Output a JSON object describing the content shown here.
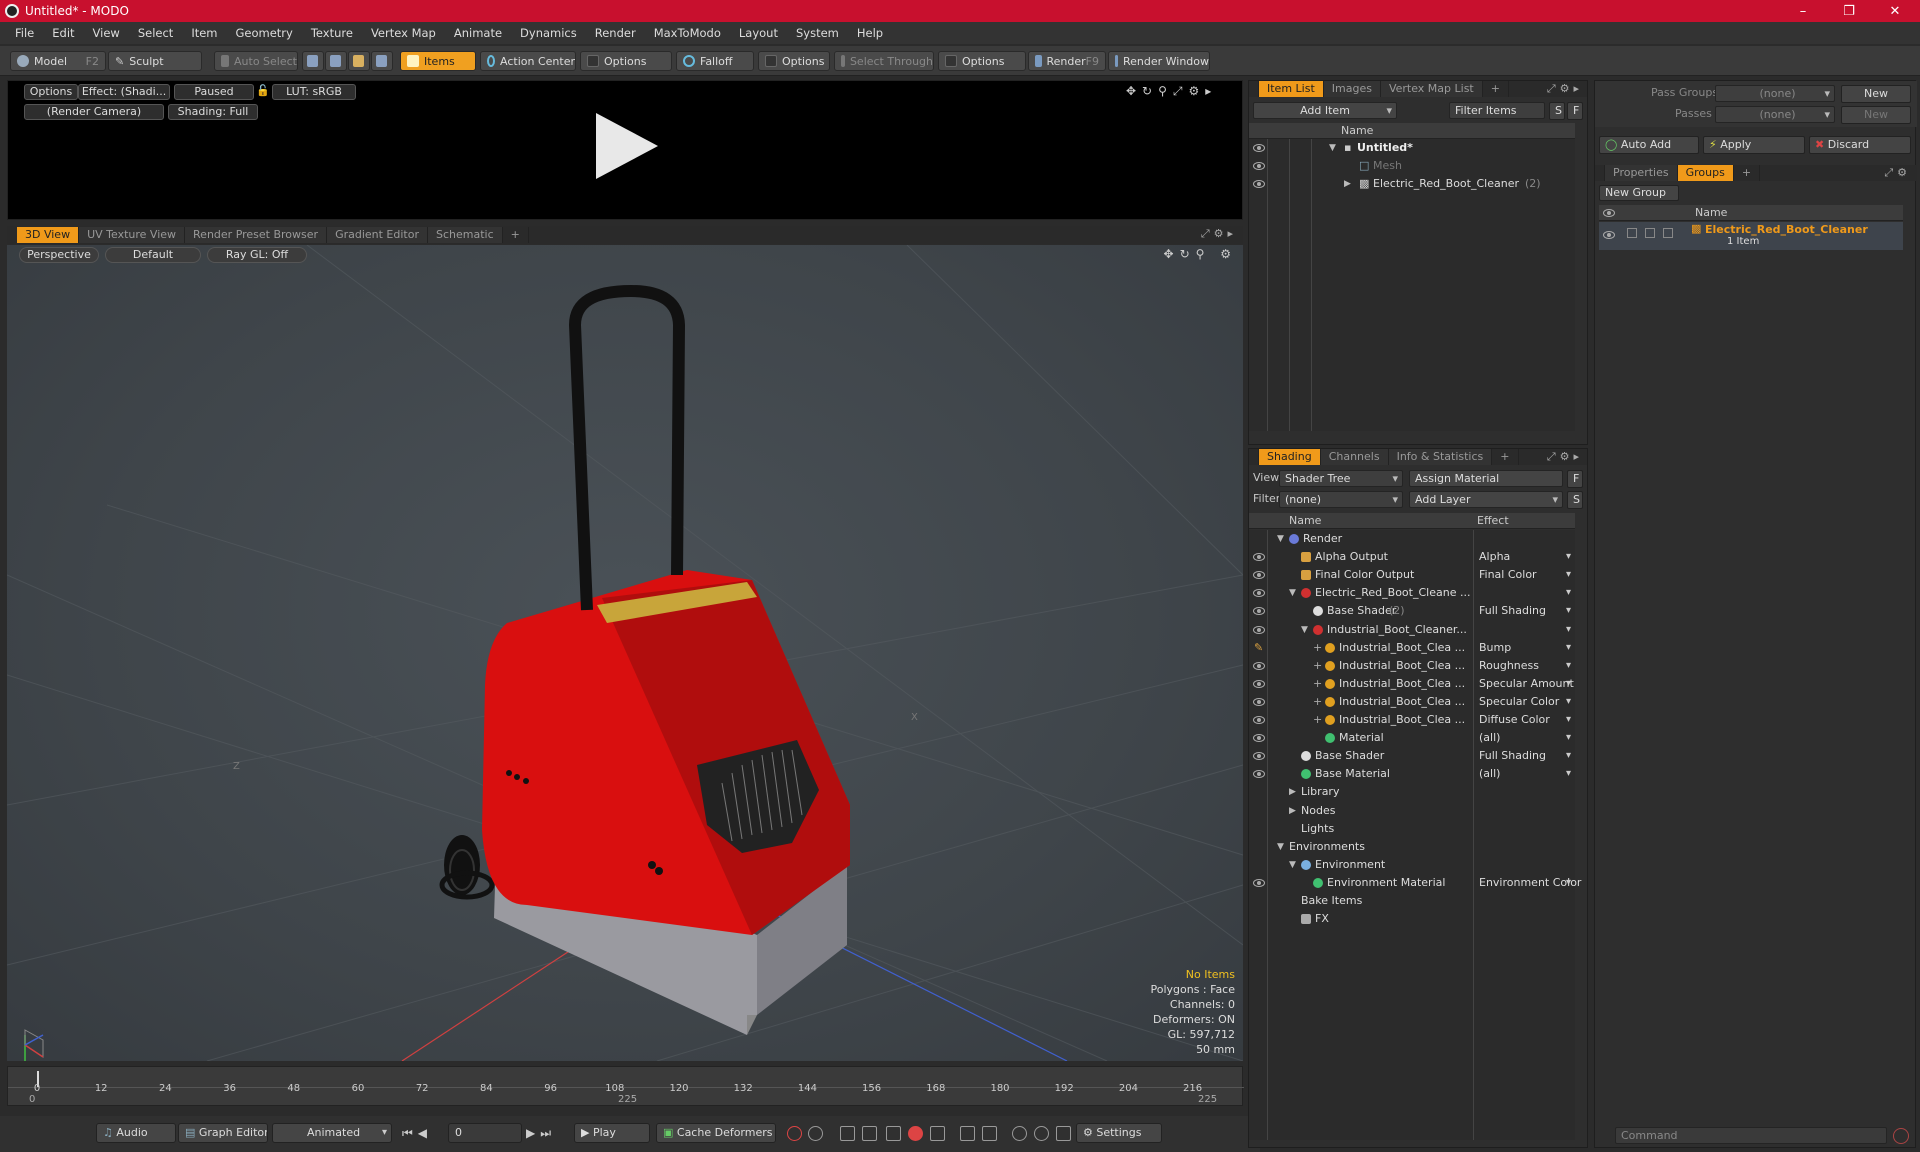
{
  "window": {
    "title": "Untitled* - MODO",
    "min": "–",
    "max": "❐",
    "close": "✕"
  },
  "menu": [
    "File",
    "Edit",
    "View",
    "Select",
    "Item",
    "Geometry",
    "Texture",
    "Vertex Map",
    "Animate",
    "Dynamics",
    "Render",
    "MaxToModo",
    "Layout",
    "System",
    "Help"
  ],
  "toolbar": {
    "model": "Model",
    "model_key": "F2",
    "sculpt": "Sculpt",
    "auto_select": "Auto Select",
    "items": "Items",
    "action_center": "Action Center",
    "options1": "Options",
    "falloff": "Falloff",
    "options2": "Options",
    "select_through": "Select Through",
    "options3": "Options",
    "render": "Render",
    "render_key": "F9",
    "render_window": "Render Window"
  },
  "preview": {
    "options": "Options",
    "effect": "Effect: (Shadi...",
    "paused": "Paused",
    "lut": "LUT: sRGB",
    "camera": "(Render Camera)",
    "shading": "Shading: Full"
  },
  "viewtabs": [
    "3D View",
    "UV Texture View",
    "Render Preset Browser",
    "Gradient Editor",
    "Schematic",
    "+"
  ],
  "viewport": {
    "perspective": "Perspective",
    "default": "Default",
    "raygl": "Ray GL: Off",
    "axis_z": "Z",
    "axis_x": "X"
  },
  "stats": {
    "items": "No Items",
    "polygons": "Polygons : Face",
    "channels": "Channels: 0",
    "deformers": "Deformers: ON",
    "gl": "GL: 597,712",
    "size": "50 mm"
  },
  "timeline": {
    "ticks": [
      "0",
      "12",
      "24",
      "36",
      "48",
      "60",
      "72",
      "84",
      "96",
      "108",
      "120",
      "132",
      "144",
      "156",
      "168",
      "180",
      "192",
      "204",
      "216"
    ],
    "start": "0",
    "mid": "225",
    "end": "225"
  },
  "bottombar": {
    "audio": "Audio",
    "graph_editor": "Graph Editor",
    "animated": "Animated",
    "frame": "0",
    "play": "Play",
    "cache": "Cache Deformers",
    "settings": "Settings"
  },
  "itemlist": {
    "tabs": [
      "Item List",
      "Images",
      "Vertex Map List",
      "+"
    ],
    "add_item": "Add Item",
    "filter": "Filter Items",
    "f": "F",
    "s": "S",
    "col_name": "Name",
    "rows": [
      {
        "label": "Untitled*"
      },
      {
        "label": "Mesh"
      },
      {
        "label": "Electric_Red_Boot_Cleaner",
        "count": "(2)"
      }
    ]
  },
  "shading": {
    "tabs": [
      "Shading",
      "Channels",
      "Info & Statistics",
      "+"
    ],
    "view_label": "View",
    "view_value": "Shader Tree",
    "assign": "Assign Material",
    "filter_label": "Filter",
    "filter_value": "(none)",
    "add_layer": "Add Layer",
    "f": "F",
    "s": "S",
    "col_name": "Name",
    "col_effect": "Effect",
    "rows": [
      {
        "name": "Render",
        "effect": ""
      },
      {
        "name": "Alpha Output",
        "effect": "Alpha"
      },
      {
        "name": "Final Color Output",
        "effect": "Final Color"
      },
      {
        "name": "Electric_Red_Boot_Cleane ...",
        "effect": ""
      },
      {
        "name": "Base Shader",
        "count": "(2)",
        "effect": "Full Shading"
      },
      {
        "name": "Industrial_Boot_Cleaner...",
        "effect": ""
      },
      {
        "name": "Industrial_Boot_Clea ...",
        "effect": "Bump"
      },
      {
        "name": "Industrial_Boot_Clea ...",
        "effect": "Roughness"
      },
      {
        "name": "Industrial_Boot_Clea ...",
        "effect": "Specular Amount"
      },
      {
        "name": "Industrial_Boot_Clea ...",
        "effect": "Specular Color"
      },
      {
        "name": "Industrial_Boot_Clea ...",
        "effect": "Diffuse Color"
      },
      {
        "name": "Material",
        "effect": "(all)"
      },
      {
        "name": "Base Shader",
        "effect": "Full Shading"
      },
      {
        "name": "Base Material",
        "effect": "(all)"
      },
      {
        "name": "Library",
        "effect": ""
      },
      {
        "name": "Nodes",
        "effect": ""
      },
      {
        "name": "Lights",
        "effect": ""
      },
      {
        "name": "Environments",
        "effect": ""
      },
      {
        "name": "Environment",
        "effect": ""
      },
      {
        "name": "Environment Material",
        "effect": "Environment Color"
      },
      {
        "name": "Bake Items",
        "effect": ""
      },
      {
        "name": "FX",
        "effect": ""
      }
    ]
  },
  "right": {
    "pass_groups": "Pass Groups",
    "pass_groups_val": "(none)",
    "new": "New",
    "passes": "Passes",
    "passes_val": "(none)",
    "new2": "New",
    "auto_add": "Auto Add",
    "apply": "Apply",
    "discard": "Discard",
    "tabs": [
      "Properties",
      "Groups",
      "+"
    ],
    "new_group": "New Group",
    "col_name": "Name",
    "group_name": "Electric_Red_Boot_Cleaner",
    "group_count": "1 Item",
    "command": "Command"
  },
  "colors": {
    "accent": "#f09a1a",
    "titlebar": "#c8102e",
    "boot_red": "#d90f0f"
  }
}
